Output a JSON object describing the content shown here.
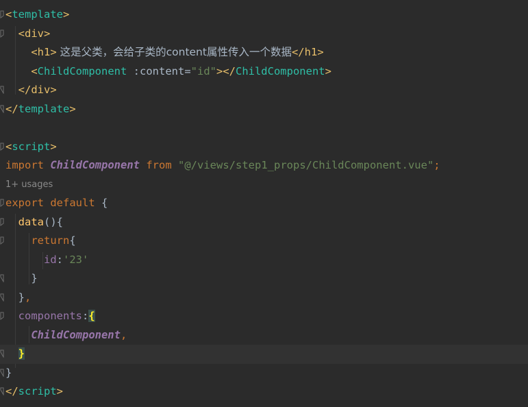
{
  "editor": {
    "language": "Vue",
    "usages_hint": "1+ usages",
    "lines": {
      "l1": {
        "t1": "<",
        "t2": "template",
        "t3": ">"
      },
      "l2": {
        "t1": "<",
        "t2": "div",
        "t3": ">"
      },
      "l3": {
        "t1": "<",
        "t2": "h1",
        "t3": ">",
        "text": " 这是父类，会给子类的content属性传入一个数据",
        "t4": "</",
        "t5": "h1",
        "t6": ">"
      },
      "l4": {
        "t1": "<",
        "t2": "ChildComponent",
        "attr": " :content=",
        "val": "\"id\"",
        "t3": "></",
        "t4": "ChildComponent",
        "t5": ">"
      },
      "l5": {
        "t1": "</",
        "t2": "div",
        "t3": ">"
      },
      "l6": {
        "t1": "</",
        "t2": "template",
        "t3": ">"
      },
      "l8": {
        "t1": "<",
        "t2": "script",
        "t3": ">"
      },
      "l9": {
        "kw1": "import",
        "name": "ChildComponent",
        "kw2": "from",
        "str": "\"@/views/step1_props/ChildComponent.vue\"",
        "semi": ";"
      },
      "l10": {
        "kw1": "export",
        "kw2": "default",
        "brace": "{"
      },
      "l11": {
        "fn": "data",
        "rest": "(){"
      },
      "l12": {
        "kw": "return",
        "brace": "{"
      },
      "l13": {
        "key": "id",
        "colon": ":",
        "val": "'23'"
      },
      "l14": {
        "brace": "}"
      },
      "l15": {
        "brace": "}",
        "comma": ","
      },
      "l16": {
        "key": "components",
        "colon": ":",
        "brace": "{"
      },
      "l17": {
        "name": "ChildComponent",
        "comma": ","
      },
      "l18": {
        "brace": "}"
      },
      "l19": {
        "brace": "}"
      },
      "l20": {
        "t1": "</",
        "t2": "script",
        "t3": ">"
      }
    }
  },
  "colors": {
    "background": "#2b2b2b",
    "current_line": "#323232",
    "tag_bracket": "#e8bf6a",
    "tag_name": "#2fbfa7",
    "keyword": "#cc7832",
    "string": "#6a8759",
    "component": "#9876aa",
    "function": "#ffc66d",
    "default_text": "#a9b7c6",
    "matched_brace": "#ffef28"
  }
}
